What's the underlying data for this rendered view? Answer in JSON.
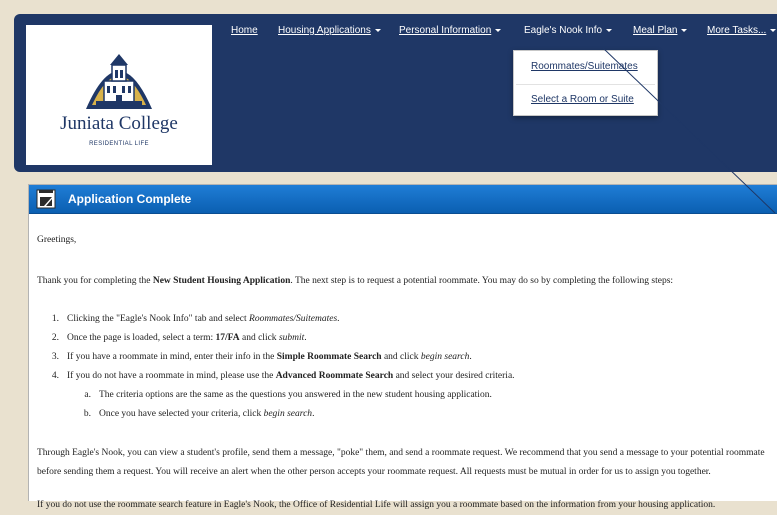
{
  "logo": {
    "name": "Juniata College",
    "sub": "RESIDENTIAL LIFE"
  },
  "nav": [
    {
      "label": "Home"
    },
    {
      "label": "Housing Applications"
    },
    {
      "label": "Personal Information"
    },
    {
      "label": "Eagle's Nook Info"
    },
    {
      "label": "Meal Plan"
    },
    {
      "label": "More Tasks..."
    }
  ],
  "dropdown": {
    "items": [
      "Roommates/Suitemates",
      "Select a Room or Suite"
    ]
  },
  "panel": {
    "title": "Application Complete"
  },
  "content": {
    "greeting": "Greetings,",
    "p1_a": "Thank you for completing the ",
    "p1_b": "New Student Housing Application",
    "p1_c": ". The next step is to request a potential roommate. You may do so by completing the following steps:",
    "s1_num": "1.",
    "s1_a": "Clicking the \"Eagle's Nook Info\" tab and select ",
    "s1_b": "Roommates/Suitemates",
    "s1_c": ".",
    "s2_num": "2.",
    "s2_a": "Once the page is loaded, select a term: ",
    "s2_b": "17/FA",
    "s2_c": " and click ",
    "s2_d": "submit",
    "s2_e": ".",
    "s3_num": "3.",
    "s3_a": "If you have a roommate in mind, enter their info in the ",
    "s3_b": "Simple Roommate Search",
    "s3_c": " and click ",
    "s3_d": "begin search",
    "s3_e": ".",
    "s4_num": "4.",
    "s4_a": "If you do not have a roommate in mind, please use the ",
    "s4_b": "Advanced Roommate Search",
    "s4_c": " and select your desired criteria.",
    "sa_num": "a.",
    "sa_text": "The criteria options are the same as the questions you answered in the new student housing application.",
    "sb_num": "b.",
    "sb_a": "Once you have selected your criteria, click ",
    "sb_b": "begin search",
    "sb_c": ".",
    "p2": "Through Eagle's Nook, you can view a student's profile, send them a message, \"poke\" them, and send a roommate request. We recommend that you send a message to your potential roommate before sending them a request. You will receive an alert when the other person accepts your roommate request. All requests must be mutual in order for us to assign you together.",
    "p3": "If you do not use the roommate search feature in Eagle's Nook, the Office of Residential Life will assign you a roommate based on the information from your housing application."
  },
  "colors": {
    "header": "#1f3766",
    "panel_head": "#0b5fb1",
    "background": "#e9e1cf"
  }
}
